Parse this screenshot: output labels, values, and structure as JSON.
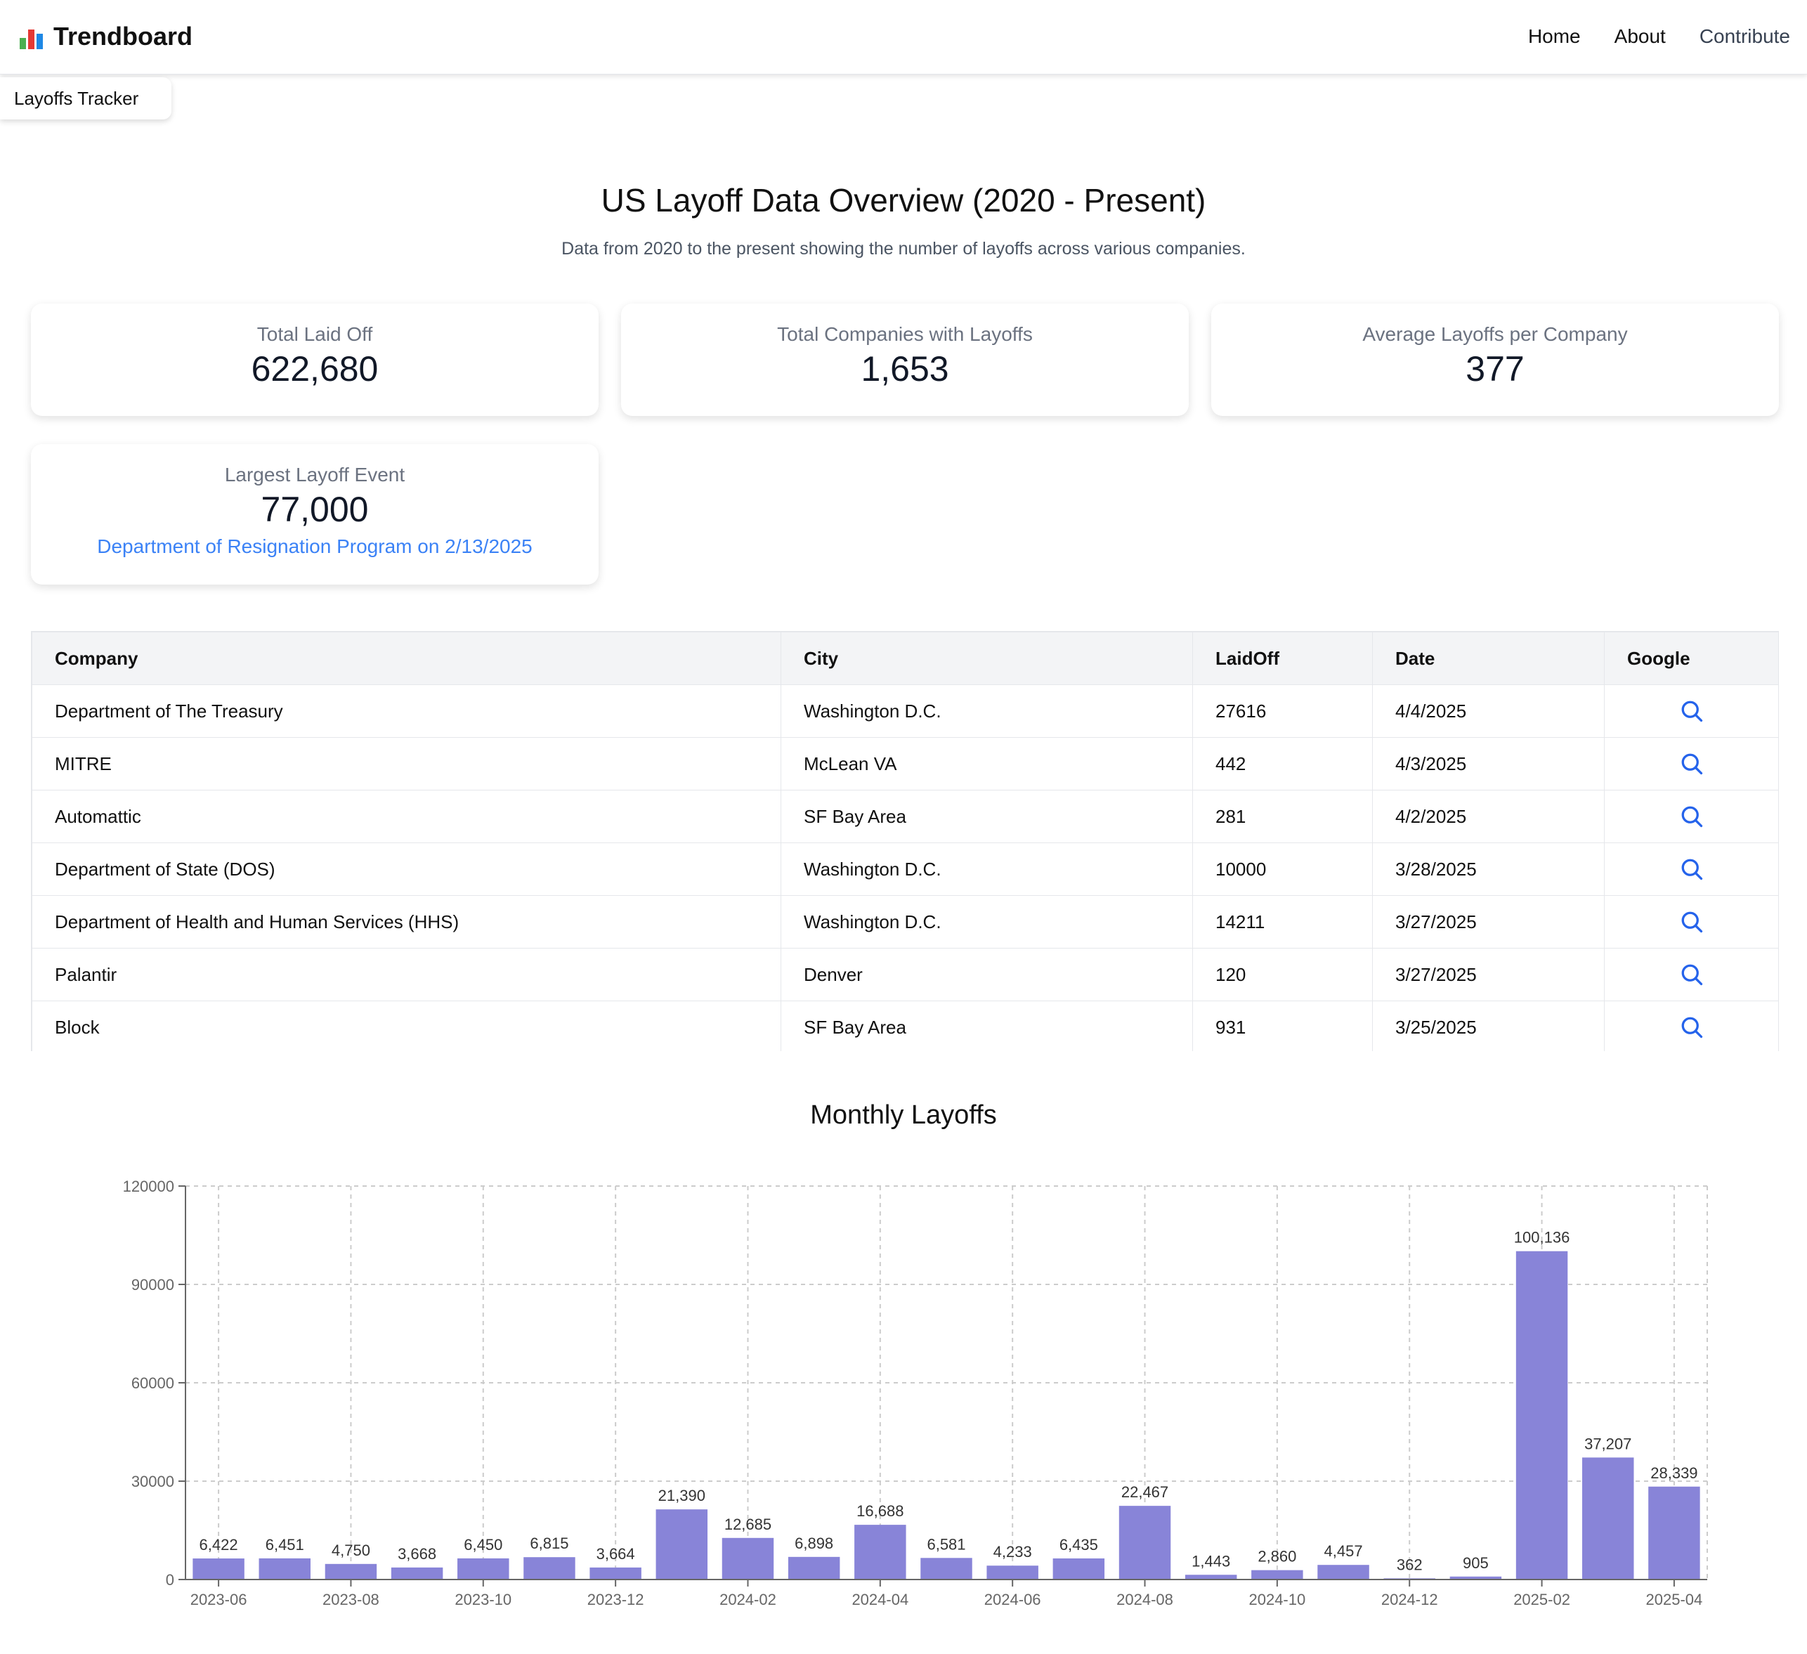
{
  "nav": {
    "brand": "Trendboard",
    "links": [
      "Home",
      "About",
      "Contribute"
    ]
  },
  "tab_chip": "Layoffs Tracker",
  "header": {
    "title": "US Layoff Data Overview (2020 - Present)",
    "subtitle": "Data from 2020 to the present showing the number of layoffs across various companies."
  },
  "stats": {
    "total_laid_off": {
      "label": "Total Laid Off",
      "value": "622,680"
    },
    "total_companies": {
      "label": "Total Companies with Layoffs",
      "value": "1,653"
    },
    "avg_per_company": {
      "label": "Average Layoffs per Company",
      "value": "377"
    },
    "largest_event": {
      "label": "Largest Layoff Event",
      "value": "77,000",
      "detail": "Department of Resignation Program on 2/13/2025"
    }
  },
  "table": {
    "columns": [
      "Company",
      "City",
      "LaidOff",
      "Date",
      "Google"
    ],
    "rows": [
      {
        "company": "Department of The Treasury",
        "city": "Washington D.C.",
        "laid_off": "27616",
        "date": "4/4/2025"
      },
      {
        "company": "MITRE",
        "city": "McLean VA",
        "laid_off": "442",
        "date": "4/3/2025"
      },
      {
        "company": "Automattic",
        "city": "SF Bay Area",
        "laid_off": "281",
        "date": "4/2/2025"
      },
      {
        "company": "Department of State (DOS)",
        "city": "Washington D.C.",
        "laid_off": "10000",
        "date": "3/28/2025"
      },
      {
        "company": "Department of Health and Human Services (HHS)",
        "city": "Washington D.C.",
        "laid_off": "14211",
        "date": "3/27/2025"
      },
      {
        "company": "Palantir",
        "city": "Denver",
        "laid_off": "120",
        "date": "3/27/2025"
      },
      {
        "company": "Block",
        "city": "SF Bay Area",
        "laid_off": "931",
        "date": "3/25/2025"
      }
    ]
  },
  "colors": {
    "accent": "#3b82f6",
    "bar": "#8884d8"
  },
  "icons": {
    "google_search": "search-icon"
  },
  "chart_data": {
    "type": "bar",
    "title": "Monthly Layoffs",
    "xlabel": "",
    "ylabel": "",
    "ylim": [
      0,
      120000
    ],
    "yticks": [
      0,
      30000,
      60000,
      90000,
      120000
    ],
    "grid": true,
    "categories": [
      "2023-06",
      "2023-07",
      "2023-08",
      "2023-09",
      "2023-10",
      "2023-11",
      "2023-12",
      "2024-01",
      "2024-02",
      "2024-03",
      "2024-04",
      "2024-05",
      "2024-06",
      "2024-07",
      "2024-08",
      "2024-09",
      "2024-10",
      "2024-11",
      "2024-12",
      "2025-01",
      "2025-02",
      "2025-03",
      "2025-04"
    ],
    "tick_labels": [
      "2023-06",
      "2023-08",
      "2023-10",
      "2023-12",
      "2024-02",
      "2024-04",
      "2024-06",
      "2024-08",
      "2024-10",
      "2024-12",
      "2025-02",
      "2025-04"
    ],
    "values": [
      6422,
      6451,
      4750,
      3668,
      6450,
      6815,
      3664,
      21390,
      12685,
      6898,
      16688,
      6581,
      4233,
      6435,
      22467,
      1443,
      2860,
      4457,
      362,
      905,
      100136,
      37207,
      28339
    ],
    "value_labels": [
      "6,422",
      "6,451",
      "4,750",
      "3,668",
      "6,450",
      "6,815",
      "3,664",
      "21,390",
      "12,685",
      "6,898",
      "16,688",
      "6,581",
      "4,233",
      "6,435",
      "22,467",
      "1,443",
      "2,860",
      "4,457",
      "362",
      "905",
      "100,136",
      "37,207",
      "28,339"
    ]
  }
}
